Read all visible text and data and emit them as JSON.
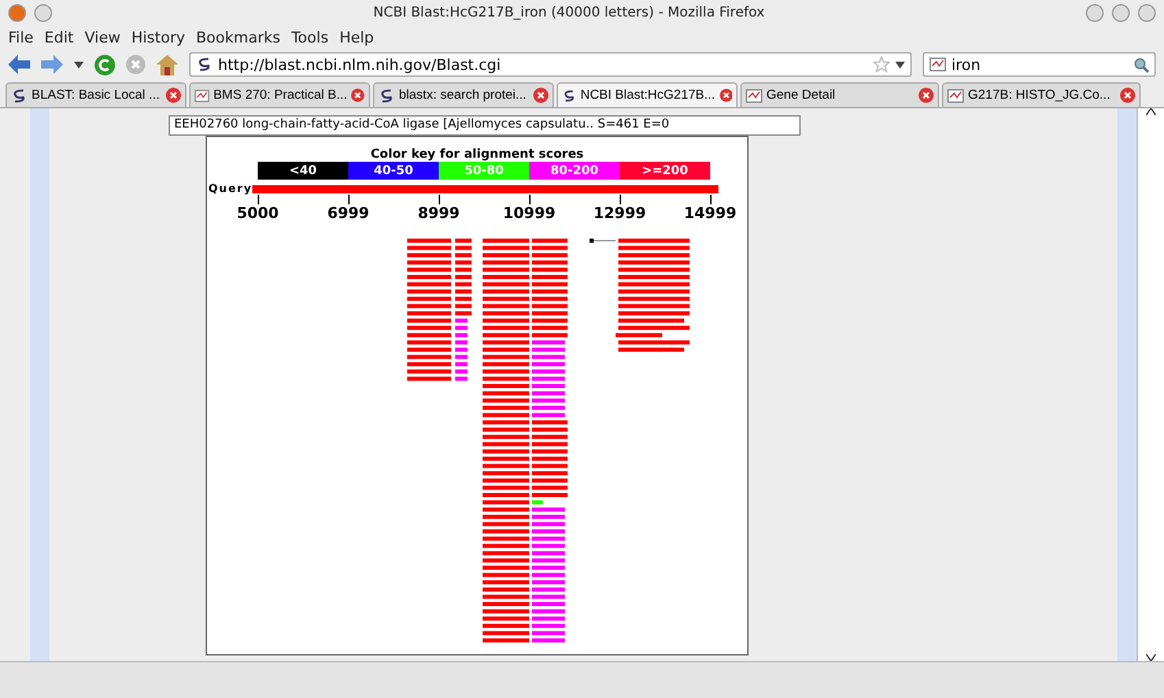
{
  "window": {
    "title": "NCBI Blast:HcG217B_iron (40000 letters) - Mozilla Firefox"
  },
  "menu": [
    {
      "label": "File"
    },
    {
      "label": "Edit"
    },
    {
      "label": "View"
    },
    {
      "label": "History"
    },
    {
      "label": "Bookmarks"
    },
    {
      "label": "Tools"
    },
    {
      "label": "Help"
    }
  ],
  "address_bar": {
    "value": "http://blast.ncbi.nlm.nih.gov/Blast.cgi"
  },
  "search": {
    "value": "iron"
  },
  "tabs": [
    {
      "label": "BLAST: Basic Local ...",
      "selected": false,
      "kind": "ncbi"
    },
    {
      "label": "BMS 270: Practical B...",
      "selected": false,
      "kind": "page"
    },
    {
      "label": "blastx: search protei...",
      "selected": false,
      "kind": "ncbi"
    },
    {
      "label": "NCBI Blast:HcG217B...",
      "selected": true,
      "kind": "ncbi"
    },
    {
      "label": "Gene Detail",
      "selected": false,
      "kind": "page"
    },
    {
      "label": "G217B: HISTO_JG.Co...",
      "selected": false,
      "kind": "page"
    }
  ],
  "hover_text": "EEH02760 long-chain-fatty-acid-CoA ligase [Ajellomyces capsulatu.. S=461 E=0",
  "graphic": {
    "title": "Color key for alignment scores",
    "key": [
      {
        "label": "<40",
        "color": "#000000"
      },
      {
        "label": "40-50",
        "color": "#2200ff"
      },
      {
        "label": "50-80",
        "color": "#22ff00"
      },
      {
        "label": "80-200",
        "color": "#ff00ff"
      },
      {
        "label": ">=200",
        "color": "#ff0033"
      }
    ],
    "query_label": "Query",
    "ticks": [
      "5000",
      "6999",
      "8999",
      "10999",
      "12999",
      "14999"
    ]
  }
}
